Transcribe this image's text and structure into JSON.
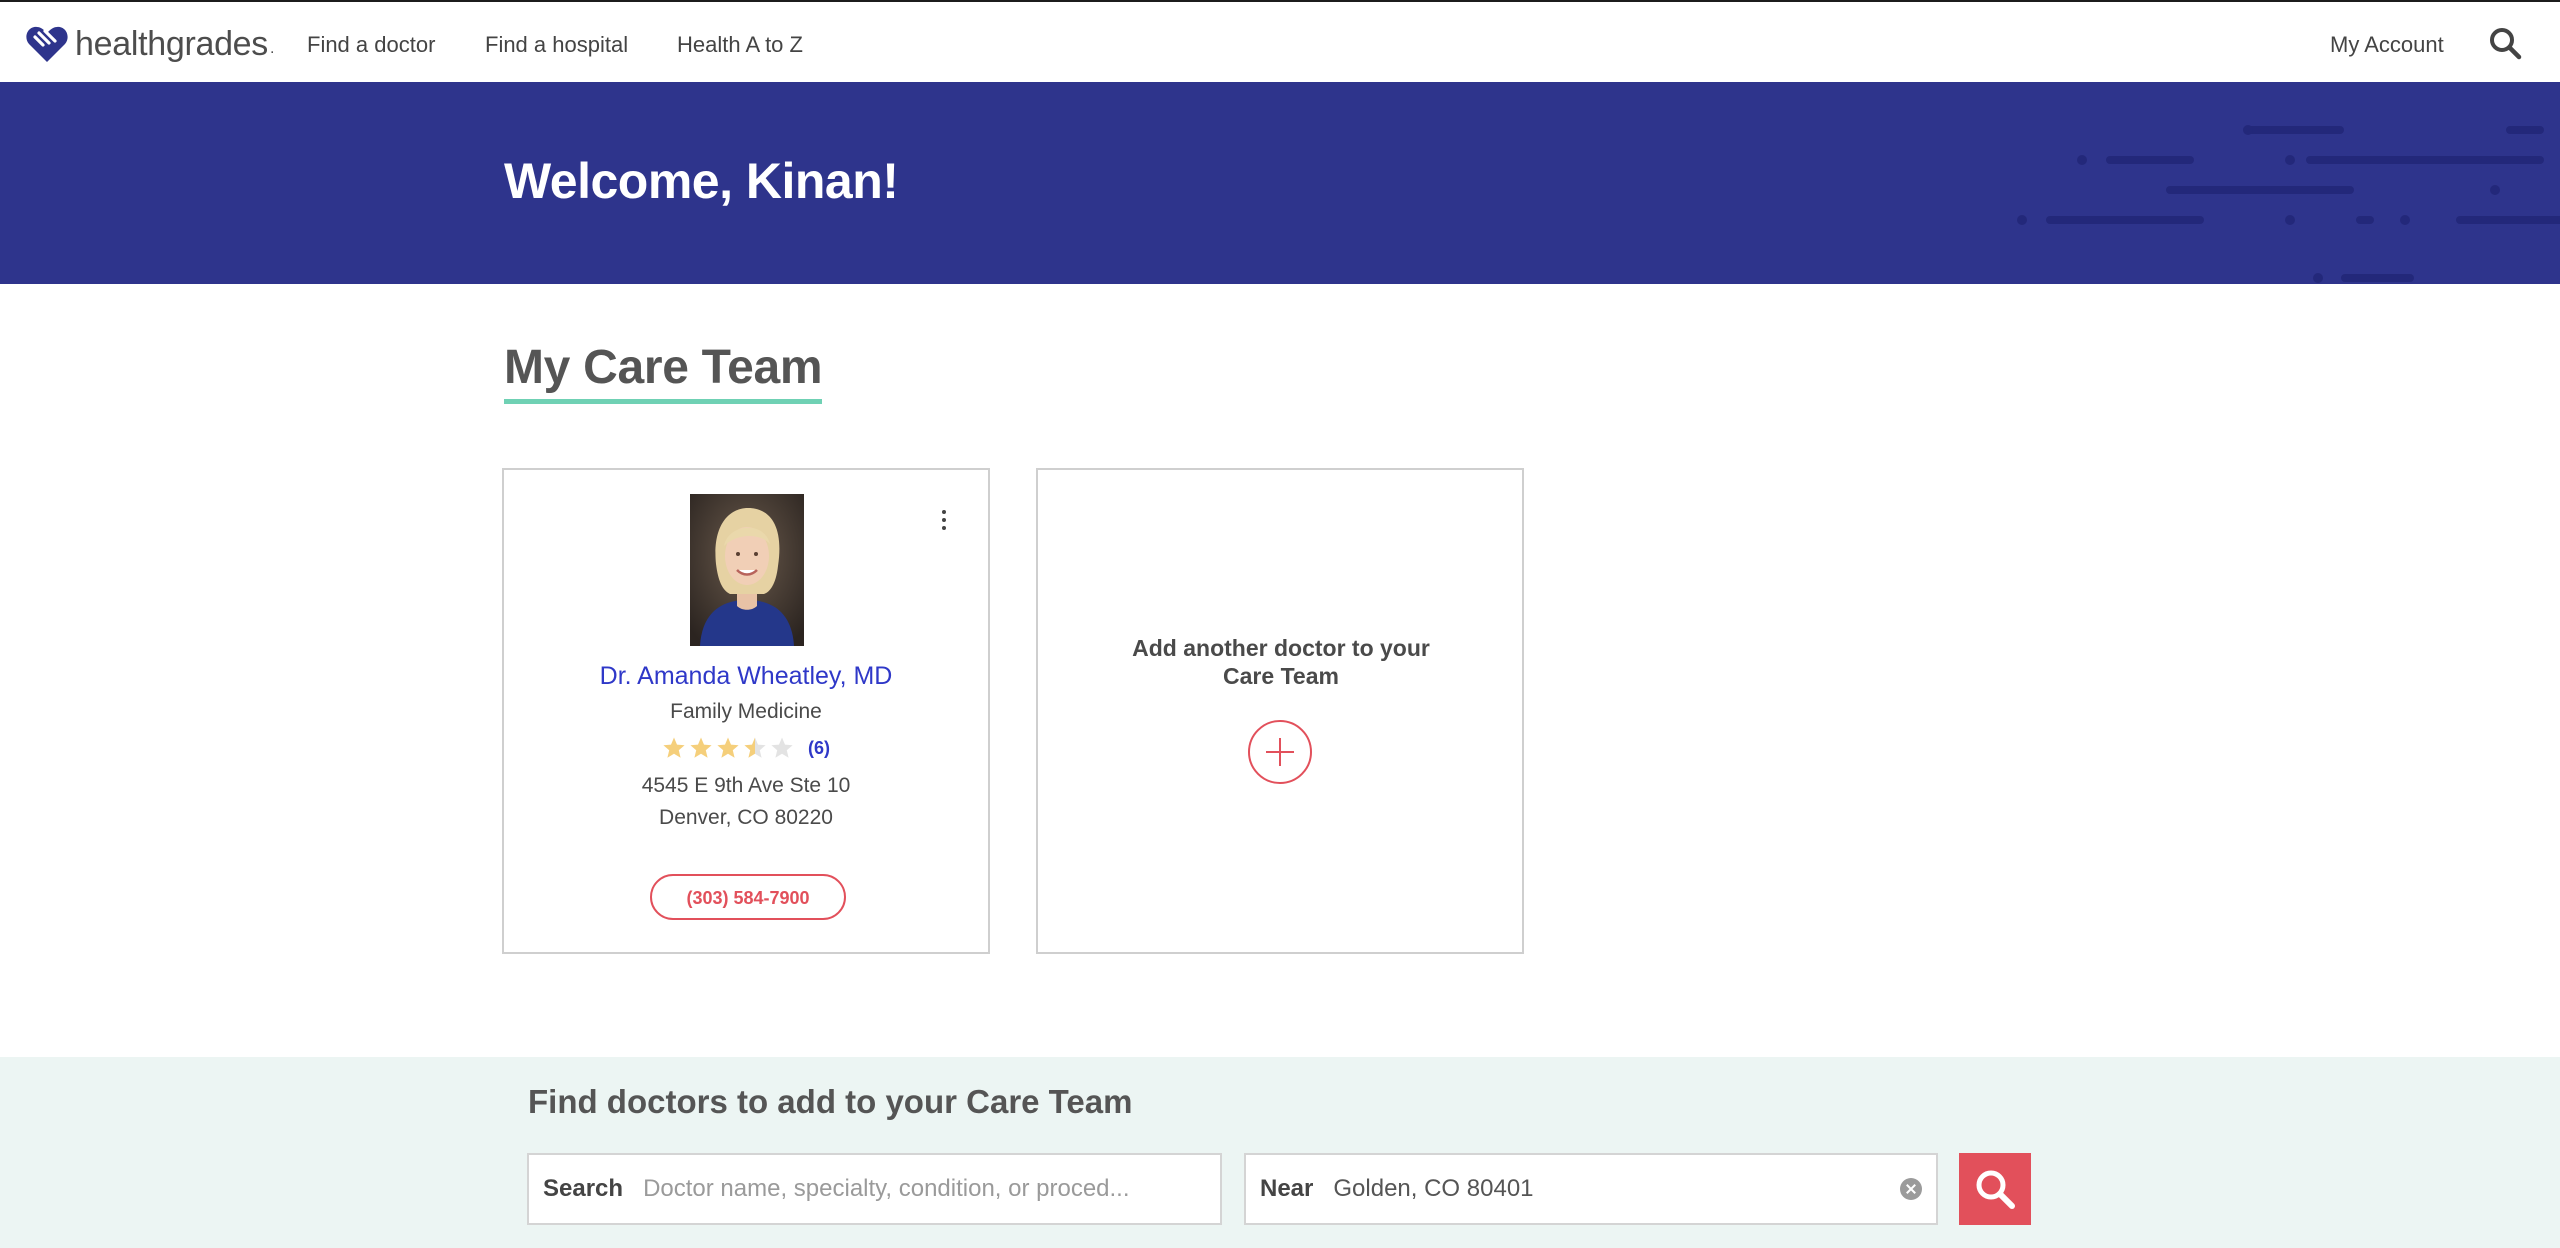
{
  "nav": {
    "brand": "healthgrades",
    "brand_mark": ".",
    "links": [
      "Find a doctor",
      "Find a hospital",
      "Health A to Z"
    ],
    "account": "My Account",
    "search_icon": "search-icon"
  },
  "banner": {
    "welcome": "Welcome, Kinan!"
  },
  "care_team": {
    "title": "My Care Team",
    "doctor": {
      "name": "Dr. Amanda Wheatley, MD",
      "specialty": "Family Medicine",
      "rating": 3.5,
      "rating_max": 5,
      "review_count": "(6)",
      "address_line1": "4545 E 9th Ave Ste 10",
      "address_line2": "Denver, CO 80220",
      "phone": "(303) 584-7900"
    },
    "add_card": {
      "text_line1": "Add another doctor to your",
      "text_line2": "Care Team"
    }
  },
  "find": {
    "title": "Find doctors to add to your Care Team",
    "search_label": "Search",
    "search_placeholder": "Doctor name, specialty, condition, or proced...",
    "near_label": "Near",
    "near_value": "Golden, CO 80401"
  },
  "colors": {
    "brand_blue": "#2e348c",
    "accent_red": "#e2505b",
    "underline_green": "#6fd1b4",
    "link_blue": "#2f38c8",
    "star_filled": "#f5cf7b",
    "star_empty": "#e3e3e3"
  }
}
